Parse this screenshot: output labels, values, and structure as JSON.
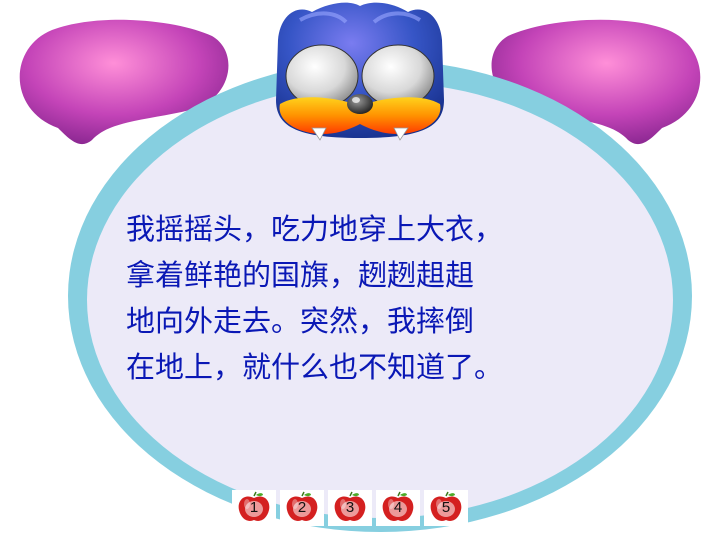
{
  "passage": {
    "lines": [
      "我摇摇头，吃力地穿上大衣，",
      "拿着鲜艳的国旗，趔趔趄趄",
      "地向外走去。突然，我摔倒",
      "在地上，就什么也不知道了。"
    ]
  },
  "nav": {
    "buttons": [
      {
        "label": "1"
      },
      {
        "label": "2"
      },
      {
        "label": "3"
      },
      {
        "label": "4"
      },
      {
        "label": "5"
      }
    ]
  },
  "colors": {
    "text": "#0a18b5",
    "frame_ring": "#86cfe0",
    "frame_fill": "#eceaf8",
    "wing": "#b13bb0",
    "mascot_head": "#2d52b8",
    "beak": "#ff7a00",
    "apple": "#d42020"
  }
}
